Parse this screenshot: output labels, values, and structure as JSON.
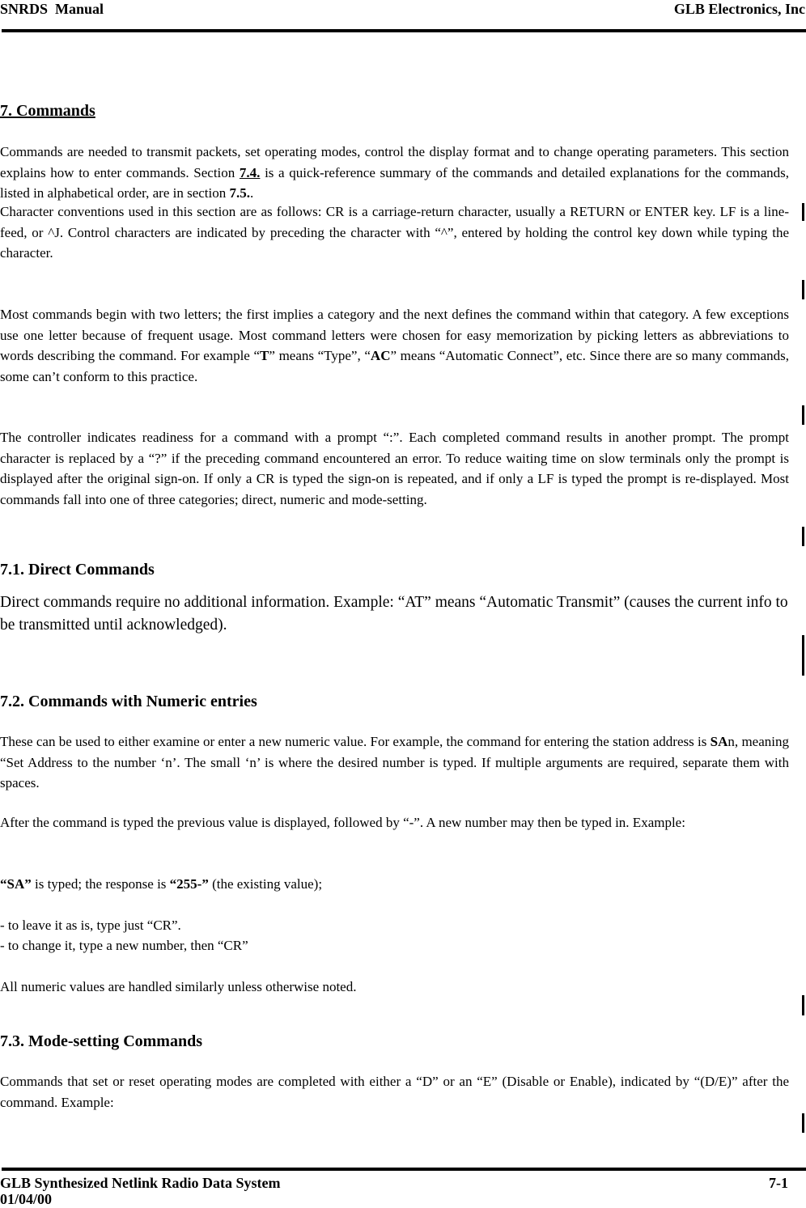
{
  "header": {
    "left": "SNRDS  Manual",
    "right": "GLB Electronics, Inc"
  },
  "footer": {
    "title": "GLB Synthesized Netlink Radio Data System",
    "page": "7-1",
    "date": "01/04/00"
  },
  "section7": {
    "title": "7. Commands",
    "p1": {
      "a": "Commands are needed to transmit packets, set operating modes, control the display format and to change operating parameters. This section explains how to enter commands. Section ",
      "ref1": "7.4.",
      "b": " is a quick-reference summary of the commands and detailed explanations for the commands, listed in alphabetical order, are in section ",
      "ref2": "7.5.",
      "c": "."
    },
    "p2": "Character conventions used in this section are as follows: CR is a carriage-return character, usually a RETURN or ENTER key. LF is a line- feed, or ^J. Control characters are indicated by preceding the character with “^”, entered by holding the control key down while typing the character.",
    "p3": {
      "a": "Most commands begin with two letters; the first implies a category and the next defines the command within that category. A few exceptions use one letter because of frequent usage. Most command letters were chosen for easy memorization by picking letters as abbreviations to words describing the command. For example “",
      "k1": "T",
      "b": "” means “Type”, “",
      "k2": "AC",
      "c": "” means “Automatic Connect”, etc. Since there are so many commands, some can’t conform to this practice."
    },
    "p4": "The controller indicates readiness for a command with a prompt “:”. Each completed command results in another prompt. The prompt character is replaced by a “?” if the preceding command encountered an error. To reduce waiting time on slow terminals only the prompt is displayed after the original sign-on. If only a CR is typed the sign-on is repeated, and if only a LF is typed the prompt is re-displayed. Most commands fall into one of three categories; direct, numeric and mode-setting."
  },
  "section71": {
    "title": "7.1. Direct Commands",
    "p1": "Direct commands require no additional information. Example: “AT” means “Automatic Transmit” (causes the current info to be transmitted until acknowledged)."
  },
  "section72": {
    "title": "7.2. Commands with Numeric entries",
    "p1": {
      "a": "These can be used to either examine or enter a new numeric value. For example, the command for entering the station address is ",
      "k": "SA",
      "b": "n, meaning “Set Address to the number ‘n’. The small ‘n’ is where the desired number is typed. If multiple arguments are required, separate them with spaces."
    },
    "p2": "After the command is typed the previous value is displayed, followed by “-”. A new number may then be typed in. Example:",
    "example": {
      "k1": "“SA”",
      "a": " is typed; the response is ",
      "k2": "“255-”",
      "b": " (the existing value);"
    },
    "bullet1": "- to leave it as is, type just “CR”.",
    "bullet2": "- to change it, type a new number, then “CR”",
    "p3": "All numeric values are handled similarly unless otherwise noted."
  },
  "section73": {
    "title": "7.3. Mode-setting Commands",
    "p1": "Commands that set or reset operating modes are completed with either a “D” or an “E” (Disable or Enable), indicated by “(D/E)” after the command. Example:"
  }
}
